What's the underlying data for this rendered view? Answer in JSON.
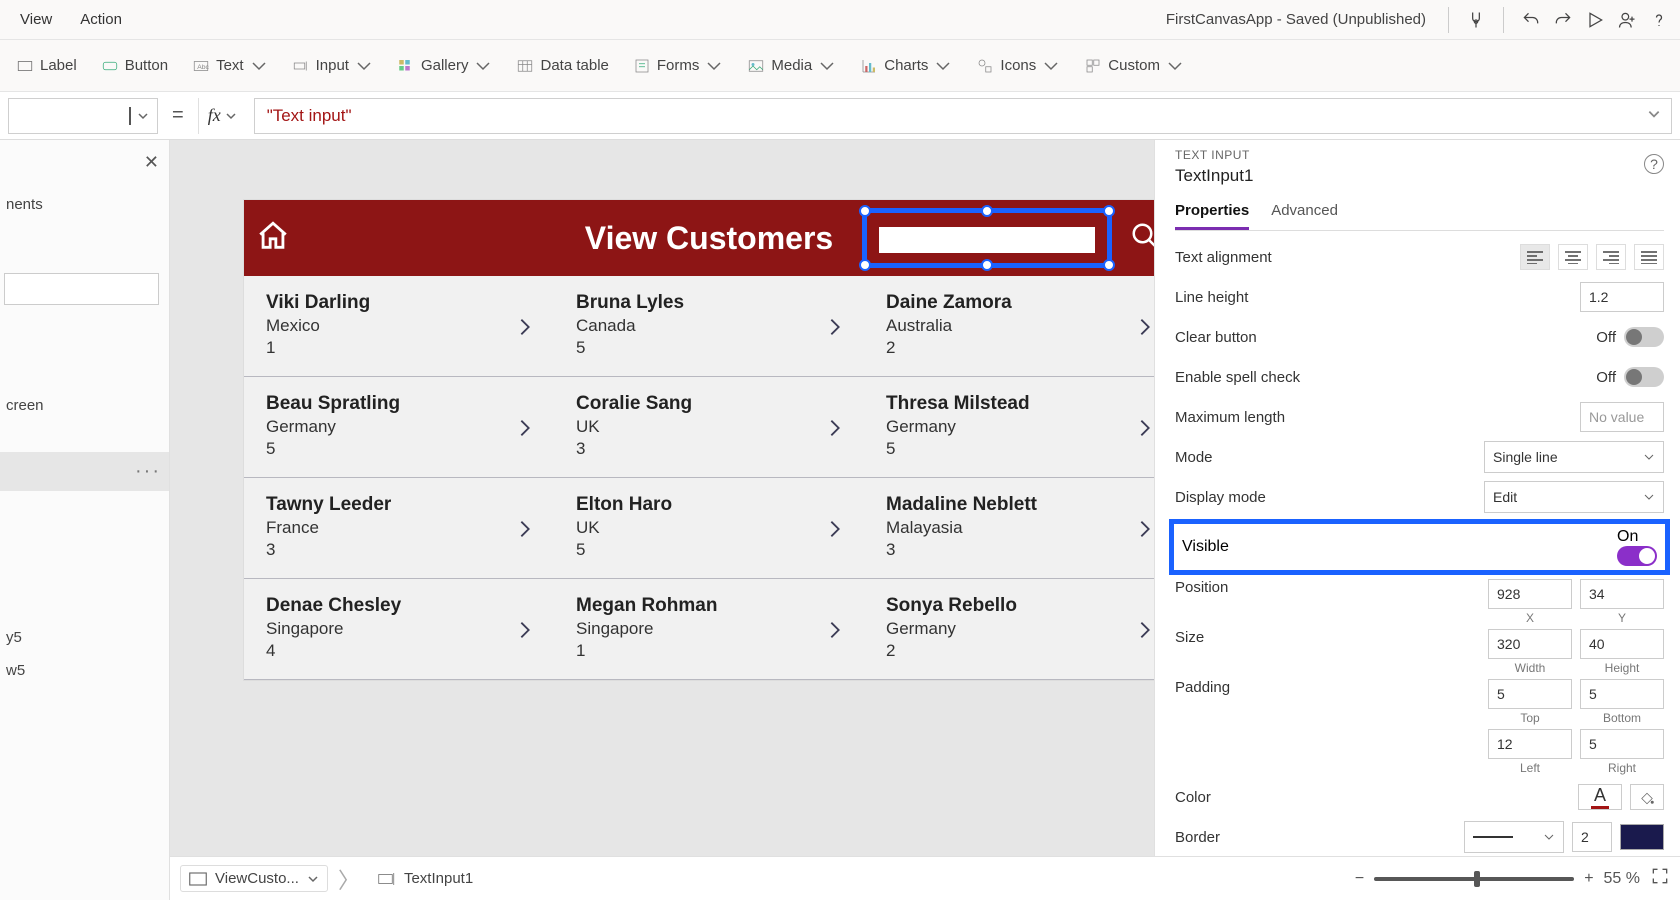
{
  "menu": {
    "view": "View",
    "action": "Action"
  },
  "app_title": "FirstCanvasApp - Saved (Unpublished)",
  "ribbon": {
    "label": "Label",
    "button": "Button",
    "text": "Text",
    "input": "Input",
    "gallery": "Gallery",
    "datatable": "Data table",
    "forms": "Forms",
    "media": "Media",
    "charts": "Charts",
    "icons": "Icons",
    "custom": "Custom"
  },
  "formula": {
    "value": "\"Text input\""
  },
  "tree": {
    "search_lbl": "nents",
    "items": [
      "",
      "creen",
      "",
      "y5",
      "w5"
    ]
  },
  "canvas": {
    "header_title": "View Customers",
    "customers": [
      [
        {
          "name": "Viki  Darling",
          "country": "Mexico",
          "num": "1"
        },
        {
          "name": "Bruna  Lyles",
          "country": "Canada",
          "num": "5"
        },
        {
          "name": "Daine  Zamora",
          "country": "Australia",
          "num": "2"
        }
      ],
      [
        {
          "name": "Beau  Spratling",
          "country": "Germany",
          "num": "5"
        },
        {
          "name": "Coralie  Sang",
          "country": "UK",
          "num": "3"
        },
        {
          "name": "Thresa  Milstead",
          "country": "Germany",
          "num": "5"
        }
      ],
      [
        {
          "name": "Tawny  Leeder",
          "country": "France",
          "num": "3"
        },
        {
          "name": "Elton  Haro",
          "country": "UK",
          "num": "5"
        },
        {
          "name": "Madaline  Neblett",
          "country": "Malayasia",
          "num": "3"
        }
      ],
      [
        {
          "name": "Denae  Chesley",
          "country": "Singapore",
          "num": "4"
        },
        {
          "name": "Megan  Rohman",
          "country": "Singapore",
          "num": "1"
        },
        {
          "name": "Sonya  Rebello",
          "country": "Germany",
          "num": "2"
        }
      ]
    ]
  },
  "rpane": {
    "category": "TEXT INPUT",
    "name": "TextInput1",
    "tabs": {
      "properties": "Properties",
      "advanced": "Advanced"
    },
    "textalign": "Text alignment",
    "lineheight_l": "Line height",
    "lineheight_v": "1.2",
    "clearbtn_l": "Clear button",
    "clearbtn_v": "Off",
    "spell_l": "Enable spell check",
    "spell_v": "Off",
    "maxlen_l": "Maximum length",
    "maxlen_v": "No value",
    "mode_l": "Mode",
    "mode_v": "Single line",
    "dispmode_l": "Display mode",
    "dispmode_v": "Edit",
    "visible_l": "Visible",
    "visible_v": "On",
    "position_l": "Position",
    "pos_x": "928",
    "pos_y": "34",
    "sub_x": "X",
    "sub_y": "Y",
    "size_l": "Size",
    "size_w": "320",
    "size_h": "40",
    "sub_w": "Width",
    "sub_h": "Height",
    "padding_l": "Padding",
    "pad_t": "5",
    "pad_b": "5",
    "pad_l": "12",
    "pad_r": "5",
    "sub_t": "Top",
    "sub_b": "Bottom",
    "sub_l": "Left",
    "sub_r": "Right",
    "color_l": "Color",
    "border_l": "Border",
    "border_v": "2"
  },
  "bbar": {
    "screen": "ViewCusto...",
    "ctrl": "TextInput1",
    "zoom": "55  %"
  }
}
